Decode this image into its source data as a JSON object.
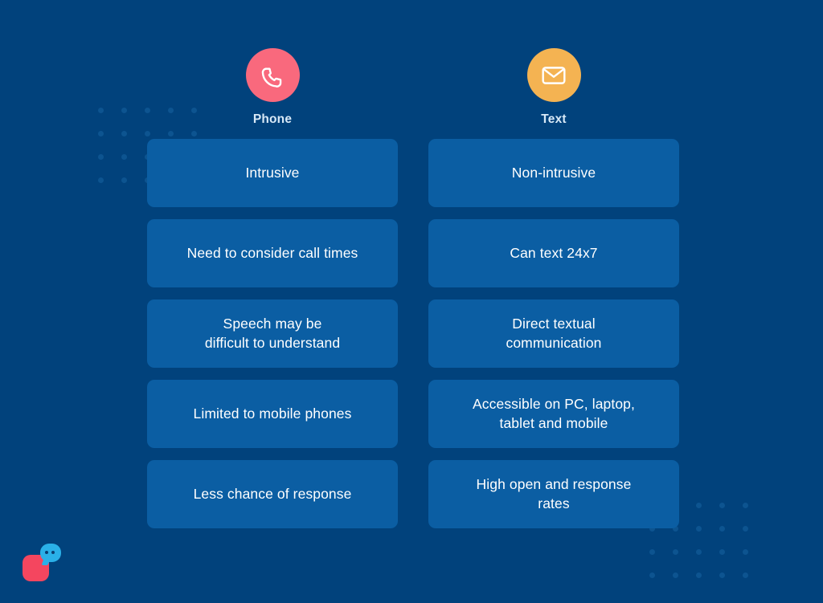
{
  "theme": {
    "background": "#01427c",
    "card_background": "#0b5ea3",
    "card_text": "#ffffff",
    "label_text": "#d8e9f7",
    "dot_color": "#0d5490",
    "phone_accent": "#f9697d",
    "text_accent": "#f4b352",
    "logo_square": "#f4465f",
    "logo_bubble": "#2ab0e8"
  },
  "columns": [
    {
      "id": "phone",
      "label": "Phone",
      "icon": "phone-handset-icon",
      "cards": [
        {
          "text": "Intrusive"
        },
        {
          "text": "Need to consider call times"
        },
        {
          "text": "Speech may be\ndifficult to understand"
        },
        {
          "text": "Limited to mobile phones"
        },
        {
          "text": "Less chance of response"
        }
      ]
    },
    {
      "id": "text",
      "label": "Text",
      "icon": "envelope-icon",
      "cards": [
        {
          "text": "Non-intrusive"
        },
        {
          "text": "Can text 24x7"
        },
        {
          "text": "Direct textual\ncommunication"
        },
        {
          "text": "Accessible on PC, laptop,\ntablet and mobile"
        },
        {
          "text": "High open and response\nrates"
        }
      ]
    }
  ],
  "decorations": {
    "dot_grid_top_left": {
      "columns": 5,
      "rows": 4
    },
    "dot_grid_bottom_right": {
      "columns": 5,
      "rows": 4
    }
  },
  "logo": {
    "name": "chat-bubble-logo",
    "dot_count": 2
  }
}
